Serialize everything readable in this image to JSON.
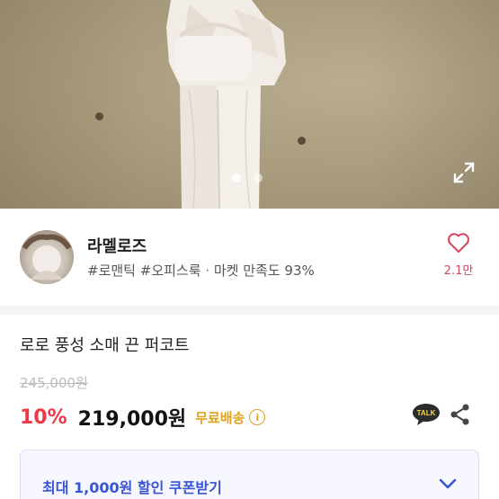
{
  "hero": {
    "slide_count": 2,
    "active_slide": 1,
    "expand_icon": "expand-icon"
  },
  "seller": {
    "name": "라멜로즈",
    "tag1": "#로맨틱",
    "tag2": "#오피스룩",
    "separator": "·",
    "satisfaction": "마켓 만족도 93%",
    "like_count": "2.1만",
    "like_icon": "heart-icon"
  },
  "product": {
    "title": "로로 풍성 소매 끈 퍼코트",
    "original_price": "245,000원",
    "discount": "10%",
    "price": "219,000원",
    "shipping": "무료배송",
    "info_glyph": "i",
    "talk_label": "TALK"
  },
  "coupon": {
    "label": "최대 1,000원 할인 쿠폰받기"
  },
  "colors": {
    "accent_red": "#f0384a",
    "shipping_gold": "#e0a21e",
    "coupon_blue": "#3a54d6",
    "heart_pink": "#d6455f"
  }
}
